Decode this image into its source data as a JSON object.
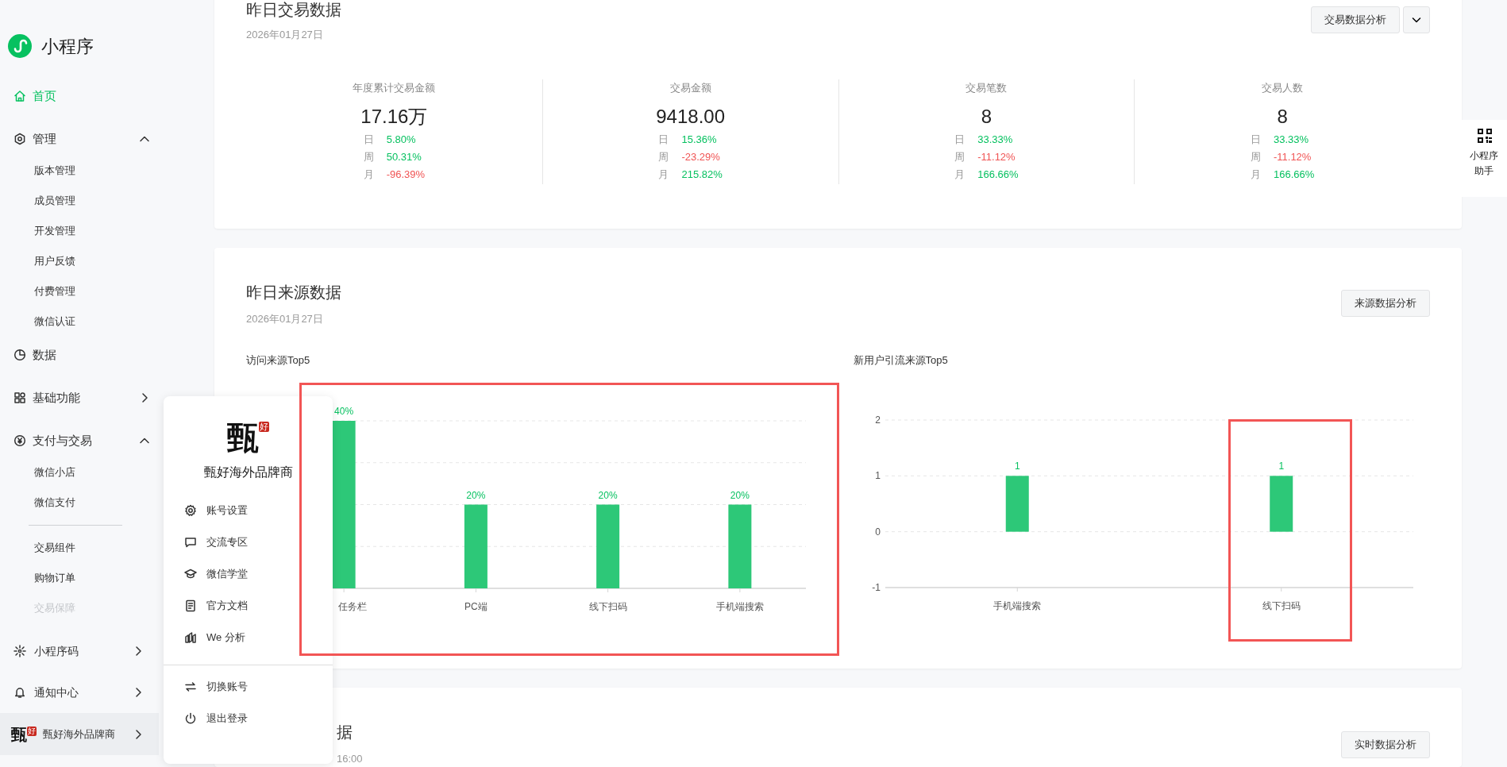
{
  "sidebar": {
    "brand": "小程序",
    "items": [
      {
        "label": "首页",
        "selected": true
      },
      {
        "label": "管理",
        "selected": false,
        "expanded": true,
        "children": [
          {
            "label": "版本管理",
            "separated": false,
            "disabled": false
          },
          {
            "label": "成员管理",
            "separated": false,
            "disabled": false
          },
          {
            "label": "开发管理",
            "separated": false,
            "disabled": false
          },
          {
            "label": "用户反馈",
            "separated": false,
            "disabled": false
          },
          {
            "label": "付费管理",
            "separated": false,
            "disabled": false
          },
          {
            "label": "微信认证",
            "separated": false,
            "disabled": false
          }
        ]
      },
      {
        "label": "数据",
        "selected": false
      },
      {
        "label": "基础功能",
        "selected": false,
        "expanded": false
      },
      {
        "label": "支付与交易",
        "selected": false,
        "expanded": true,
        "children": [
          {
            "label": "微信小店",
            "separated": false,
            "disabled": false
          },
          {
            "label": "微信支付",
            "separated": false,
            "disabled": false
          },
          {
            "label": "交易组件",
            "separated": true,
            "disabled": false
          },
          {
            "label": "购物订单",
            "separated": false,
            "disabled": false
          },
          {
            "label": "交易保障",
            "separated": false,
            "disabled": true
          }
        ]
      }
    ],
    "bottom_items": [
      {
        "label": "小程序码"
      },
      {
        "label": "通知中心"
      }
    ],
    "account": {
      "logo_text": "甄",
      "logo_seal": "好",
      "name": "甄好海外品牌商",
      "highlighted": true
    }
  },
  "trade_card": {
    "title": "昨日交易数据",
    "date": "2026年01月27日",
    "button": "交易数据分析",
    "stats": [
      {
        "label": "年度累计交易金额",
        "value": "17.16万",
        "changes": [
          {
            "period": "日",
            "value": "5.80%",
            "color": "#07c160"
          },
          {
            "period": "周",
            "value": "50.31%",
            "color": "#07c160"
          },
          {
            "period": "月",
            "value": "-96.39%",
            "color": "#f05454"
          }
        ]
      },
      {
        "label": "交易金额",
        "value": "9418.00",
        "changes": [
          {
            "period": "日",
            "value": "15.36%",
            "color": "#07c160"
          },
          {
            "period": "周",
            "value": "-23.29%",
            "color": "#f05454"
          },
          {
            "period": "月",
            "value": "215.82%",
            "color": "#07c160"
          }
        ]
      },
      {
        "label": "交易笔数",
        "value": "8",
        "changes": [
          {
            "period": "日",
            "value": "33.33%",
            "color": "#07c160"
          },
          {
            "period": "周",
            "value": "-11.12%",
            "color": "#f05454"
          },
          {
            "period": "月",
            "value": "166.66%",
            "color": "#07c160"
          }
        ]
      },
      {
        "label": "交易人数",
        "value": "8",
        "changes": [
          {
            "period": "日",
            "value": "33.33%",
            "color": "#07c160"
          },
          {
            "period": "周",
            "value": "-11.12%",
            "color": "#f05454"
          },
          {
            "period": "月",
            "value": "166.66%",
            "color": "#07c160"
          }
        ]
      }
    ]
  },
  "source_card": {
    "title": "昨日来源数据",
    "date": "2026年01月27日",
    "button": "来源数据分析",
    "charts": [
      {
        "title": "访问来源Top5",
        "chart_data": {
          "type": "bar",
          "categories": [
            "任务栏",
            "PC端",
            "线下扫码",
            "手机端搜索"
          ],
          "values": [
            40,
            20,
            20,
            20
          ],
          "data_labels": true,
          "value_labels": [
            "40%",
            "20%",
            "20%",
            "20%"
          ]
        }
      },
      {
        "title": "新用户引流来源Top5",
        "chart_data": {
          "type": "bar",
          "categories": [
            "手机端搜索",
            "线下扫码"
          ],
          "values": [
            1,
            1
          ],
          "ylim": [
            -1,
            2
          ],
          "yticks": [
            -1,
            0,
            1,
            2
          ],
          "data_labels": true,
          "value_labels": [
            "1",
            "1"
          ]
        }
      }
    ]
  },
  "realtime_card": {
    "title": "据",
    "date": "16:00",
    "button": "实时数据分析"
  },
  "popup": {
    "logo_text": "甄",
    "logo_seal": "好",
    "name": "甄好海外品牌商",
    "items": [
      {
        "label": "账号设置"
      },
      {
        "label": "交流专区"
      },
      {
        "label": "微信学堂"
      },
      {
        "label": "官方文档"
      },
      {
        "label": "We 分析"
      }
    ],
    "footer_items": [
      {
        "label": "切换账号"
      },
      {
        "label": "退出登录"
      }
    ]
  },
  "helper": {
    "label": "小程序助手"
  }
}
